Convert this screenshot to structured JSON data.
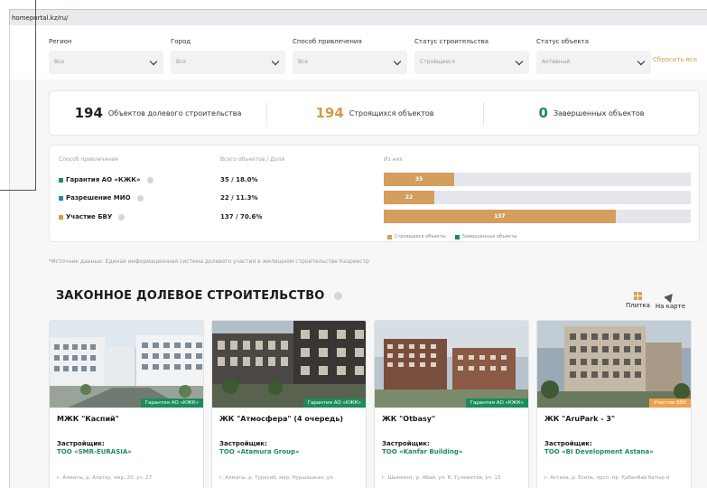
{
  "browser": {
    "url": "homeportal.kz/ru/"
  },
  "filters": {
    "items": [
      {
        "label": "Регион",
        "value": "Все"
      },
      {
        "label": "Город",
        "value": "Все"
      },
      {
        "label": "Способ привлечения",
        "value": "Все"
      },
      {
        "label": "Статус строительства",
        "value": "Строящиеся"
      },
      {
        "label": "Статус объекта",
        "value": "Активный"
      }
    ],
    "reset_label": "Сбросить все"
  },
  "stats": [
    {
      "number": "194",
      "label": "Объектов долевого строительства",
      "color": "#222222"
    },
    {
      "number": "194",
      "label": "Строящихся объектов",
      "color": "#d49a4e"
    },
    {
      "number": "0",
      "label": "Завершенных объектов",
      "color": "#1c8c5a"
    }
  ],
  "distribution": {
    "headers": {
      "method": "Способ привлечения",
      "total": "Всего объектов / Доля",
      "of_which": "Из них"
    },
    "rows": [
      {
        "name": "Гарантия АО «КЖК»",
        "value": "35 / 18.0%",
        "bar_label": "35",
        "bar_fraction": 0.23,
        "color": "#1c8c5a"
      },
      {
        "name": "Разрешение МИО",
        "value": "22 / 11.3%",
        "bar_label": "22",
        "bar_fraction": 0.165,
        "color": "#2b7fc2"
      },
      {
        "name": "Участие БВУ",
        "value": "137 / 70.6%",
        "bar_label": "137",
        "bar_fraction": 0.755,
        "color": "#d49a4e"
      }
    ],
    "legend": [
      {
        "label": "Строящиеся объекты",
        "color": "#d39e5e"
      },
      {
        "label": "Завершенные объекты",
        "color": "#1c8c5a"
      }
    ]
  },
  "source_note": "*Источник данных: Единая информационная система долевого участия в жилищном строительстве Казреестр",
  "section": {
    "title": "ЗАКОННОЕ ДОЛЕВОЕ СТРОИТЕЛЬСТВО",
    "view_tiles": "Плитка",
    "view_map": "На карте"
  },
  "cards": [
    {
      "badge": "Гарантия АО «КЖК»",
      "badge_color": "#1c8c5a",
      "name": "МЖК \"Каспий\"",
      "developer_label": "Застройщик:",
      "developer": "ТОО «SMR-EURASIA»",
      "address": "г. Алматы, р. Алатау, мкр. 20, уч. 27"
    },
    {
      "badge": "Гарантия АО «КЖК»",
      "badge_color": "#1c8c5a",
      "name": "ЖК \"Атмосфера\" (4 очередь)",
      "developer_label": "Застройщик:",
      "developer": "ТОО «Atamura Group»",
      "address": "г. Алматы, р. Турксиб, мкр. Нуршашкан, ул."
    },
    {
      "badge": "Гарантия АО «КЖК»",
      "badge_color": "#1c8c5a",
      "name": "ЖК \"Otbasy\"",
      "developer_label": "Застройщик:",
      "developer": "ТОО «Kanfar Building»",
      "address": "г. Шымкент, р. Абай, ул. К. Тулеметов, уч. 13"
    },
    {
      "badge": "Участие БВУ",
      "badge_color": "#f0a04b",
      "name": "ЖК \"AruPark - 3\"",
      "developer_label": "Застройщик:",
      "developer": "ТОО «BI Development Astana»",
      "address": "г. Астана, р. Есиль, прсп. пр. Қабанбай батыр и"
    }
  ]
}
